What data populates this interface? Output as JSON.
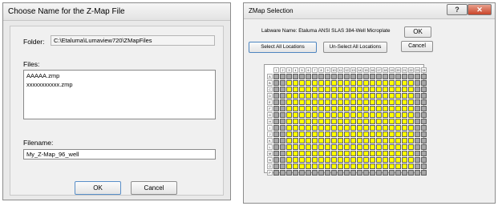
{
  "left_dialog": {
    "title": "Choose Name for the Z-Map File",
    "folder_label": "Folder:",
    "folder_path": "C:\\Etaluma\\Lumaview720\\ZMapFiles",
    "files_label": "Files:",
    "files": [
      "AAAAA.zmp",
      "xxxxxxxxxxx.zmp"
    ],
    "filename_label": "Filename:",
    "filename_value": "My_Z-Map_96_well",
    "ok_label": "OK",
    "cancel_label": "Cancel"
  },
  "right_dialog": {
    "title": "ZMap Selection",
    "labware_name": "Labware Name: Etaluma ANSI SLAS 384-Well Microplate",
    "select_all_label": "Select All Locations",
    "unselect_all_label": "Un-Select All Locations",
    "ok_label": "OK",
    "cancel_label": "Cancel",
    "help_icon_label": "?",
    "close_icon_label": "✕",
    "plate": {
      "columns": [
        "1",
        "2",
        "3",
        "4",
        "5",
        "6",
        "7",
        "8",
        "9",
        "10",
        "11",
        "12",
        "13",
        "14",
        "15",
        "16",
        "17",
        "18",
        "19",
        "20",
        "21",
        "22",
        "23",
        "24"
      ],
      "rows": [
        "A",
        "B",
        "C",
        "D",
        "E",
        "F",
        "G",
        "H",
        "I",
        "J",
        "K",
        "L",
        "M",
        "N",
        "O",
        "P"
      ],
      "selected_rows": [
        "B",
        "C",
        "D",
        "E",
        "F",
        "G",
        "H",
        "I",
        "J",
        "K",
        "L",
        "M",
        "N",
        "O"
      ],
      "selected_columns": [
        "3",
        "4",
        "5",
        "6",
        "7",
        "8",
        "9",
        "10",
        "11",
        "12",
        "13",
        "14",
        "15",
        "16",
        "17",
        "18",
        "19",
        "20",
        "21",
        "22"
      ],
      "selected_color": "#ffff00",
      "unselected_color": "#a6a6a6"
    }
  }
}
